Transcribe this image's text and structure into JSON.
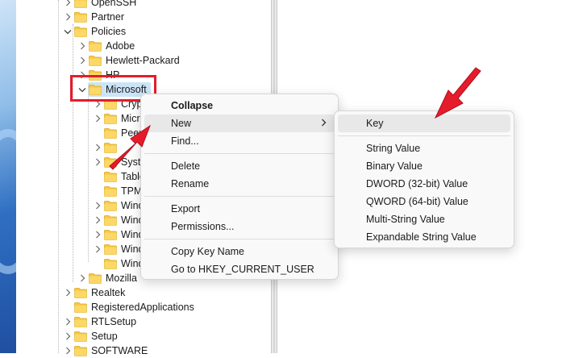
{
  "tree": {
    "items": [
      {
        "label": "OpenSSH",
        "expanded": false
      },
      {
        "label": "Partner",
        "expanded": false
      },
      {
        "label": "Policies",
        "expanded": true
      },
      {
        "label": "Adobe",
        "expanded": false
      },
      {
        "label": "Hewlett-Packard",
        "expanded": false
      },
      {
        "label": "HP",
        "expanded": false
      },
      {
        "label": "Microsoft",
        "expanded": true,
        "selected": true
      },
      {
        "label": "Cryp",
        "expanded": false
      },
      {
        "label": "Micro",
        "expanded": false
      },
      {
        "label": "Peer",
        "expanded": false
      },
      {
        "label": "",
        "expanded": false
      },
      {
        "label": "Syste",
        "expanded": false
      },
      {
        "label": "Table",
        "expanded": false
      },
      {
        "label": "TPM",
        "expanded": false
      },
      {
        "label": "Wind",
        "expanded": false
      },
      {
        "label": "Wind",
        "expanded": false
      },
      {
        "label": "Wind",
        "expanded": false
      },
      {
        "label": "Wind",
        "expanded": false
      },
      {
        "label": "Wind",
        "expanded": false
      },
      {
        "label": "Mozilla",
        "expanded": false
      },
      {
        "label": "Realtek",
        "expanded": false
      },
      {
        "label": "RegisteredApplications",
        "expanded": false
      },
      {
        "label": "RTLSetup",
        "expanded": false
      },
      {
        "label": "Setup",
        "expanded": false
      },
      {
        "label": "SOFTWARE",
        "expanded": false
      }
    ]
  },
  "context_menu": {
    "collapse": "Collapse",
    "new": "New",
    "find": "Find...",
    "delete": "Delete",
    "rename": "Rename",
    "export": "Export",
    "permissions": "Permissions...",
    "copy_key_name": "Copy Key Name",
    "goto": "Go to HKEY_CURRENT_USER"
  },
  "new_submenu": {
    "key": "Key",
    "string_value": "String Value",
    "binary_value": "Binary Value",
    "dword_value": "DWORD (32-bit) Value",
    "qword_value": "QWORD (64-bit) Value",
    "multi_string_value": "Multi-String Value",
    "expandable_string_value": "Expandable String Value"
  },
  "colors": {
    "annotation_red": "#e51c2b",
    "folder_yellow": "#f8c93e",
    "selection": "#cce4f7"
  },
  "icons": {
    "folder": "folder-icon",
    "expand": "chevron-right-icon",
    "collapse": "chevron-down-icon",
    "submenu": "chevron-right-icon"
  }
}
